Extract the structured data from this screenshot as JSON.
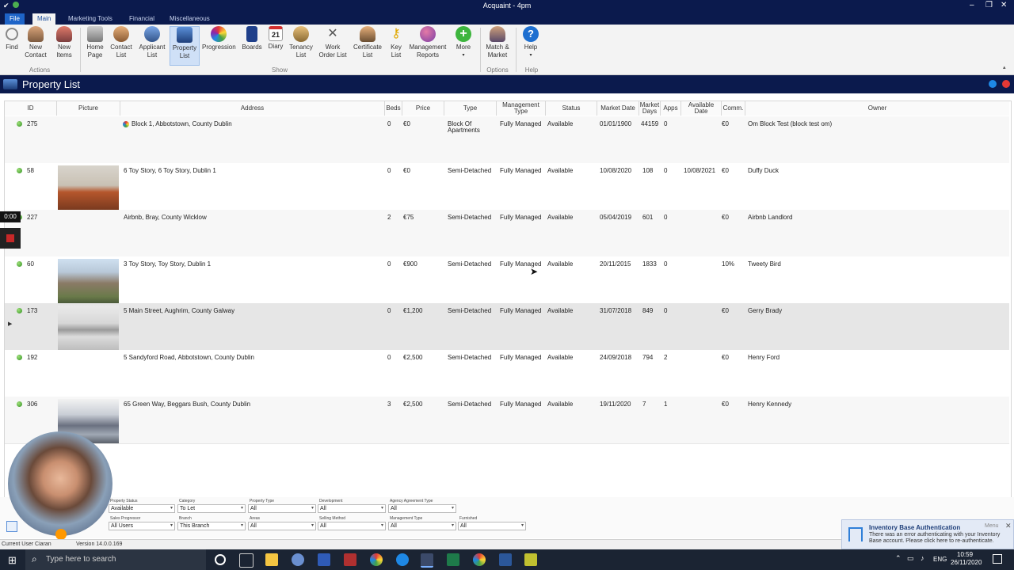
{
  "window": {
    "title": "Acquaint - 4pm"
  },
  "menu_tabs": [
    "File",
    "Main",
    "Marketing Tools",
    "Financial",
    "Miscellaneous"
  ],
  "ribbon": {
    "buttons": [
      {
        "label": "Find",
        "icon": "magnifier-icon"
      },
      {
        "label": "New\nContact",
        "icon": "new-contact-icon"
      },
      {
        "label": "New\nItems",
        "icon": "new-items-icon"
      },
      {
        "label": "Home\nPage",
        "icon": "home-page-icon"
      },
      {
        "label": "Contact\nList",
        "icon": "contact-list-icon"
      },
      {
        "label": "Applicant\nList",
        "icon": "applicant-list-icon"
      },
      {
        "label": "Property\nList",
        "icon": "property-list-icon"
      },
      {
        "label": "Progression",
        "icon": "progression-icon"
      },
      {
        "label": "Boards",
        "icon": "boards-icon"
      },
      {
        "label": "Diary",
        "icon": "diary-icon",
        "date": "21"
      },
      {
        "label": "Tenancy\nList",
        "icon": "tenancy-list-icon"
      },
      {
        "label": "Work\nOrder List",
        "icon": "work-order-icon"
      },
      {
        "label": "Certificate\nList",
        "icon": "certificate-icon"
      },
      {
        "label": "Key\nList",
        "icon": "key-icon"
      },
      {
        "label": "Management\nReports",
        "icon": "management-reports-icon"
      },
      {
        "label": "More",
        "icon": "plus-icon"
      },
      {
        "label": "Match &\nMarket",
        "icon": "match-market-icon"
      },
      {
        "label": "Help",
        "icon": "help-icon"
      }
    ],
    "groups": {
      "actions": "Actions",
      "show": "Show",
      "options": "Options",
      "help": "Help"
    }
  },
  "page_title": "Property List",
  "table": {
    "columns": [
      "ID",
      "Picture",
      "Address",
      "Beds",
      "Price",
      "Type",
      "Management Type",
      "Status",
      "Market Date",
      "Market Days",
      "Apps",
      "Available Date",
      "Comm.",
      "Owner"
    ],
    "rows": [
      {
        "id": "275",
        "picture": "",
        "address": "Block 1, Abbotstown, County Dublin",
        "beds": "0",
        "price": "€0",
        "type": "Block Of Apartments",
        "management_type": "Fully Managed",
        "status": "Available",
        "market_date": "01/01/1900",
        "market_days": "44159",
        "apps": "0",
        "available_date": "",
        "comm": "€0",
        "owner": "Om Block Test (block test om)"
      },
      {
        "id": "58",
        "picture": "living-room",
        "address": "6 Toy Story, 6 Toy Story, Dublin 1",
        "beds": "0",
        "price": "€0",
        "type": "Semi-Detached",
        "management_type": "Fully Managed",
        "status": "Available",
        "market_date": "10/08/2020",
        "market_days": "108",
        "apps": "0",
        "available_date": "10/08/2021",
        "comm": "€0",
        "owner": "Duffy Duck"
      },
      {
        "id": "227",
        "picture": "",
        "address": "Airbnb, Bray, County Wicklow",
        "beds": "2",
        "price": "€75",
        "type": "Semi-Detached",
        "management_type": "Fully Managed",
        "status": "Available",
        "market_date": "05/04/2019",
        "market_days": "601",
        "apps": "0",
        "available_date": "",
        "comm": "€0",
        "owner": "Airbnb Landlord"
      },
      {
        "id": "60",
        "picture": "house",
        "address": "3 Toy Story, Toy Story, Dublin 1",
        "beds": "0",
        "price": "€900",
        "type": "Semi-Detached",
        "management_type": "Fully Managed",
        "status": "Available",
        "market_date": "20/11/2015",
        "market_days": "1833",
        "apps": "0",
        "available_date": "",
        "comm": "10%",
        "owner": "Tweety Bird"
      },
      {
        "id": "173",
        "picture": "kitchen",
        "address": "5 Main Street, Aughrim, County Galway",
        "beds": "0",
        "price": "€1,200",
        "type": "Semi-Detached",
        "management_type": "Fully Managed",
        "status": "Available",
        "market_date": "31/07/2018",
        "market_days": "849",
        "apps": "0",
        "available_date": "",
        "comm": "€0",
        "owner": "Gerry Brady"
      },
      {
        "id": "192",
        "picture": "",
        "address": "5 Sandyford Road, Abbotstown, County Dublin",
        "beds": "0",
        "price": "€2,500",
        "type": "Semi-Detached",
        "management_type": "Fully Managed",
        "status": "Available",
        "market_date": "24/09/2018",
        "market_days": "794",
        "apps": "2",
        "available_date": "",
        "comm": "€0",
        "owner": "Henry Ford"
      },
      {
        "id": "306",
        "picture": "bridge",
        "address": "65 Green Way, Beggars Bush, County Dublin",
        "beds": "3",
        "price": "€2,500",
        "type": "Semi-Detached",
        "management_type": "Fully Managed",
        "status": "Available",
        "market_date": "19/11/2020",
        "market_days": "7",
        "apps": "1",
        "available_date": "",
        "comm": "€0",
        "owner": "Henry Kennedy"
      }
    ]
  },
  "filters": {
    "row1": [
      {
        "label": "Property Status",
        "value": "Available"
      },
      {
        "label": "Category",
        "value": "To Let"
      },
      {
        "label": "Property Type",
        "value": "All"
      },
      {
        "label": "Development",
        "value": "All"
      },
      {
        "label": "Agency Agreement Type",
        "value": "All"
      }
    ],
    "row2": [
      {
        "label": "Sales Progressor",
        "value": "All Users"
      },
      {
        "label": "Branch",
        "value": "This Branch"
      },
      {
        "label": "Areas",
        "value": "All"
      },
      {
        "label": "Selling Method",
        "value": "All"
      },
      {
        "label": "Management Type",
        "value": "All"
      },
      {
        "label": "Furnished",
        "value": "All"
      }
    ]
  },
  "status_bar": {
    "user": "Current User Ciaran",
    "version": "Version 14.0.0.169"
  },
  "recorder": {
    "time": "0:00"
  },
  "notification": {
    "title": "Inventory Base Authentication",
    "menu": "Menu",
    "message": "There was an error authenticating with your Inventory Base account. Please click here to re-authenticate."
  },
  "taskbar": {
    "search_placeholder": "Type here to search",
    "lang": "ENG",
    "time": "10:59",
    "date": "26/11/2020"
  }
}
